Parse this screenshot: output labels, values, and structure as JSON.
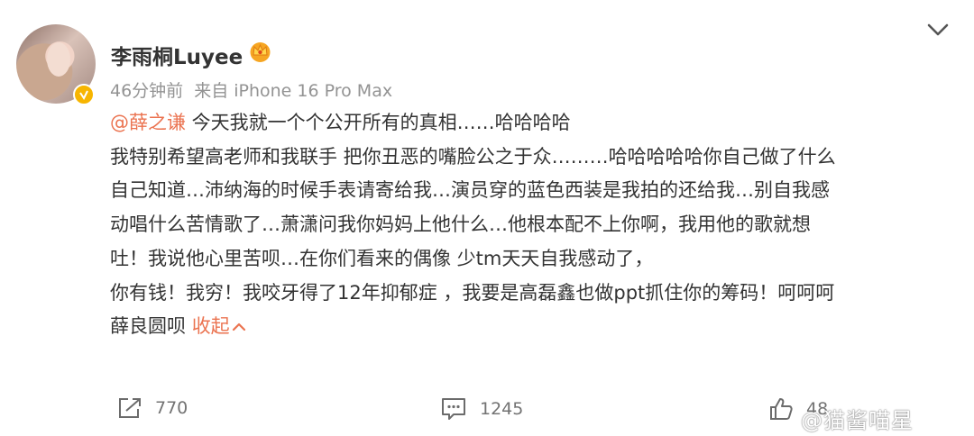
{
  "user": {
    "name": "李雨桐Luyee",
    "time": "46分钟前",
    "source": "来自 iPhone 16 Pro Max"
  },
  "post": {
    "mention": "@薛之谦",
    "line1_rest": " 今天我就一个个公开所有的真相……哈哈哈哈",
    "line2": "我特别希望高老师和我联手 把你丑恶的嘴脸公之于众………哈哈哈哈哈你自己做了什么",
    "line3": "自己知道…沛纳海的时候手表请寄给我…演员穿的蓝色西装是我拍的还给我…别自我感",
    "line4": "动唱什么苦情歌了…萧潇问我你妈妈上他什么…他根本配不上你啊，我用他的歌就想",
    "line5": "吐！我说他心里苦呗…在你们看来的偶像 少tm天天自我感动了，",
    "line6": "你有钱！我穷！我咬牙得了12年抑郁症 ，我要是高磊鑫也做ppt抓住你的筹码！呵呵呵",
    "line7": "薛良圆呗 ",
    "collapse_label": "收起"
  },
  "actions": {
    "repost_count": "770",
    "comment_count": "1245",
    "like_count": "48"
  },
  "watermark": "@猫酱喵星",
  "colors": {
    "accent": "#eb7350",
    "verified": "#f7b500",
    "meta_gray": "#939393"
  },
  "icons": [
    "crown-icon",
    "verified-badge-icon",
    "chevron-down-icon",
    "repost-icon",
    "comment-icon",
    "like-icon",
    "chevron-up-icon"
  ]
}
